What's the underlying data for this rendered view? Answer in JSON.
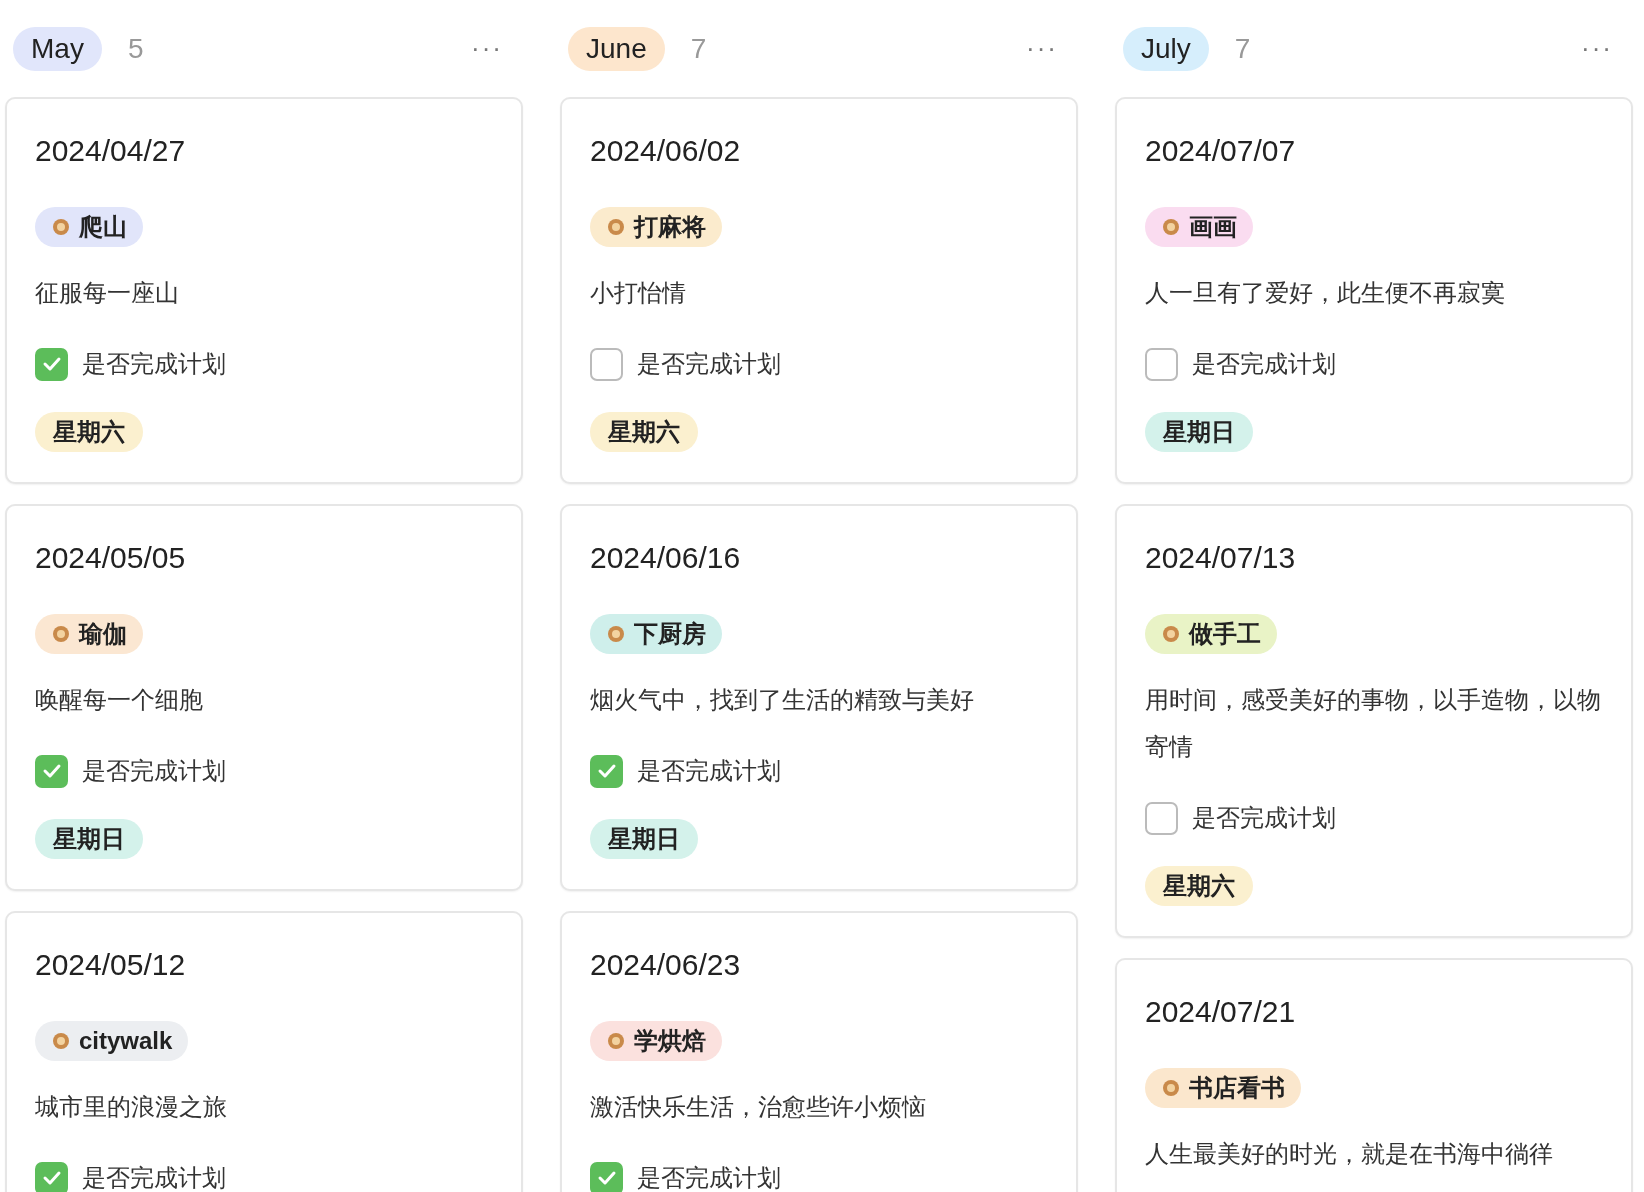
{
  "columns": [
    {
      "title": "May",
      "color": "#e1e6fb",
      "count": "5",
      "menu": "···",
      "cards": [
        {
          "date": "2024/04/27",
          "tag": {
            "label": "爬山",
            "color": "#e1e5fa"
          },
          "description": "征服每一座山",
          "done": true,
          "check_label": "是否完成计划",
          "weekday": {
            "label": "星期六",
            "color": "#fbf0cf"
          }
        },
        {
          "date": "2024/05/05",
          "tag": {
            "label": "瑜伽",
            "color": "#fbe7d2"
          },
          "description": "唤醒每一个细胞",
          "done": true,
          "check_label": "是否完成计划",
          "weekday": {
            "label": "星期日",
            "color": "#d4f2eb"
          }
        },
        {
          "date": "2024/05/12",
          "tag": {
            "label": "citywalk",
            "color": "#eceef1"
          },
          "description": "城市里的浪漫之旅",
          "done": true,
          "check_label": "是否完成计划"
        }
      ]
    },
    {
      "title": "June",
      "color": "#fde6cd",
      "count": "7",
      "menu": "···",
      "cards": [
        {
          "date": "2024/06/02",
          "tag": {
            "label": "打麻将",
            "color": "#fbebcd"
          },
          "description": "小打怡情",
          "done": false,
          "check_label": "是否完成计划",
          "weekday": {
            "label": "星期六",
            "color": "#fbf0cf"
          }
        },
        {
          "date": "2024/06/16",
          "tag": {
            "label": "下厨房",
            "color": "#cfefeb"
          },
          "description": "烟火气中，找到了生活的精致与美好",
          "done": true,
          "check_label": "是否完成计划",
          "weekday": {
            "label": "星期日",
            "color": "#d4f2eb"
          }
        },
        {
          "date": "2024/06/23",
          "tag": {
            "label": "学烘焙",
            "color": "#fbe1de"
          },
          "description": "激活快乐生活，治愈些许小烦恼",
          "done": true,
          "check_label": "是否完成计划"
        }
      ]
    },
    {
      "title": "July",
      "color": "#d6eefc",
      "count": "7",
      "menu": "···",
      "cards": [
        {
          "date": "2024/07/07",
          "tag": {
            "label": "画画",
            "color": "#fadcf0"
          },
          "description": "人一旦有了爱好，此生便不再寂寞",
          "done": false,
          "check_label": "是否完成计划",
          "weekday": {
            "label": "星期日",
            "color": "#d4f2eb"
          }
        },
        {
          "date": "2024/07/13",
          "tag": {
            "label": "做手工",
            "color": "#e9f3c6"
          },
          "description": "用时间，感受美好的事物，以手造物，以物寄情",
          "done": false,
          "check_label": "是否完成计划",
          "weekday": {
            "label": "星期六",
            "color": "#fbf0cf"
          }
        },
        {
          "date": "2024/07/21",
          "tag": {
            "label": "书店看书",
            "color": "#fbe7cd"
          },
          "description": "人生最美好的时光，就是在书海中徜徉"
        }
      ]
    }
  ]
}
